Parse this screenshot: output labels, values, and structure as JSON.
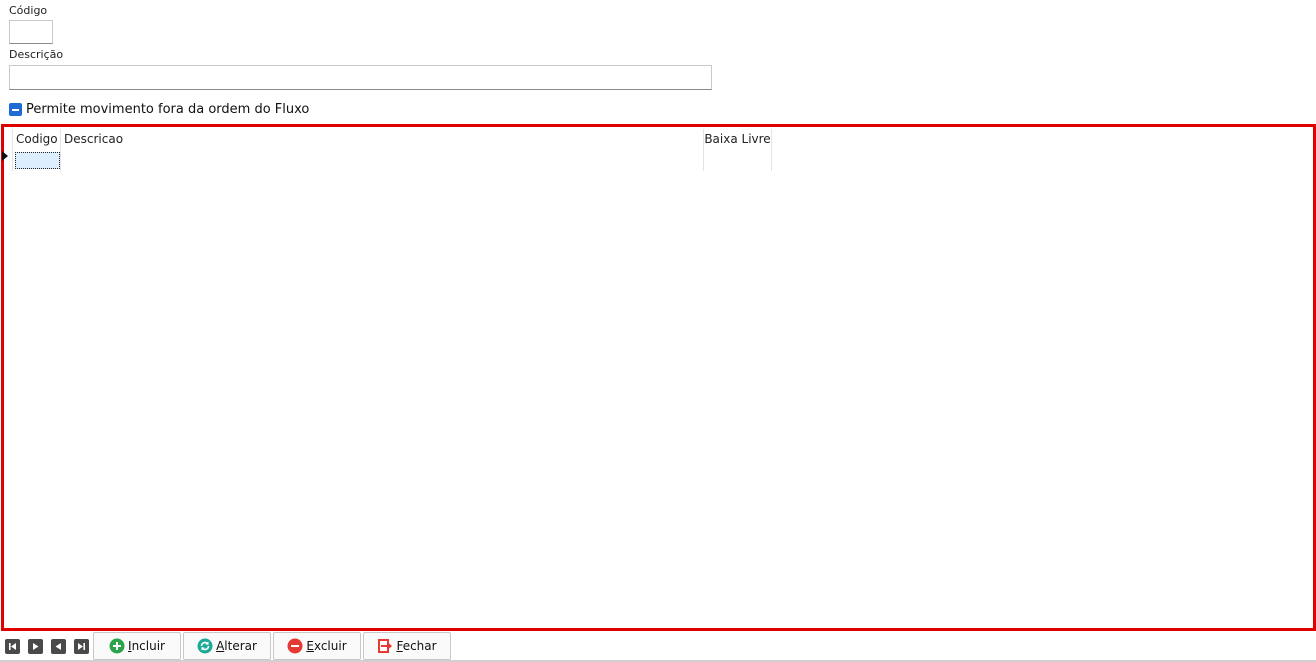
{
  "form": {
    "codigo_label": "Código",
    "codigo_value": "",
    "descricao_label": "Descrição",
    "descricao_value": "",
    "checkbox_label": "Permite movimento fora da ordem do Fluxo",
    "checkbox_state": "indeterminate"
  },
  "grid": {
    "columns": [
      "Codigo",
      "Descricao",
      "Baixa Livre"
    ],
    "rows": [
      {
        "codigo": "",
        "descricao": "",
        "baixa_livre": ""
      }
    ]
  },
  "navigator": {
    "icons": [
      "first-record-icon",
      "next-record-icon",
      "prior-record-icon",
      "last-record-icon"
    ]
  },
  "buttons": {
    "incluir": "Incluir",
    "alterar": "Alterar",
    "excluir": "Excluir",
    "fechar": "Fechar"
  },
  "colors": {
    "highlight_border": "#e00000",
    "incluir_icon": "#2aa34a",
    "alterar_icon": "#1aaa96",
    "excluir_icon": "#e53935",
    "fechar_icon": "#e53935",
    "checkbox": "#1e6bd6"
  }
}
